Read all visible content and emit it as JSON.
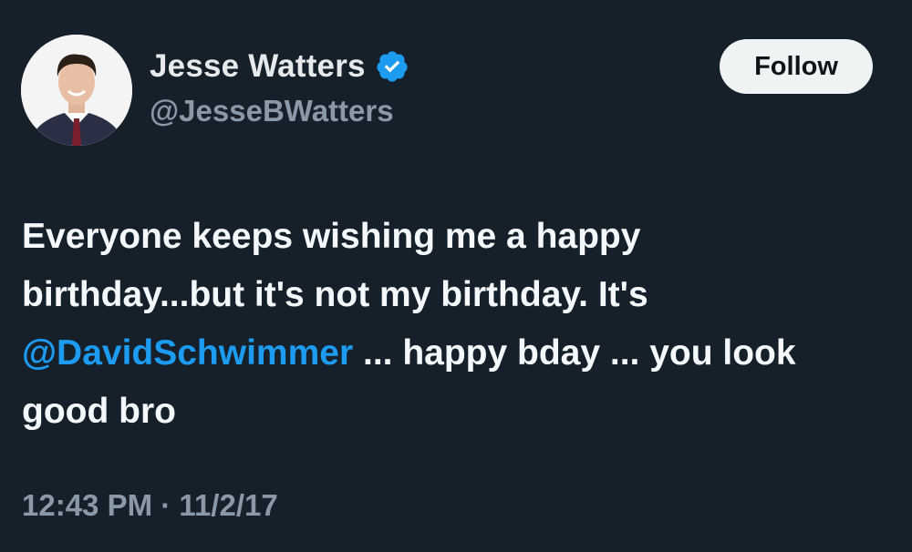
{
  "author": {
    "display_name": "Jesse Watters",
    "handle": "@JesseBWatters",
    "verified": true,
    "verified_color": "#1d9bf0",
    "avatar_icon": "profile-photo"
  },
  "follow_button": {
    "label": "Follow"
  },
  "tweet": {
    "text_before": "Everyone keeps wishing me a happy birthday...but it's not my birthday. It's",
    "mention": "@DavidSchwimmer",
    "text_after": "... happy bday ... you look good bro"
  },
  "meta": {
    "time": "12:43 PM",
    "separator": "·",
    "date": "11/2/17"
  },
  "colors": {
    "background": "#15202b",
    "text": "#e7e9ea",
    "secondary_text": "#8b98a5",
    "mention": "#1d9bf0",
    "button_bg": "#eff3f4"
  }
}
